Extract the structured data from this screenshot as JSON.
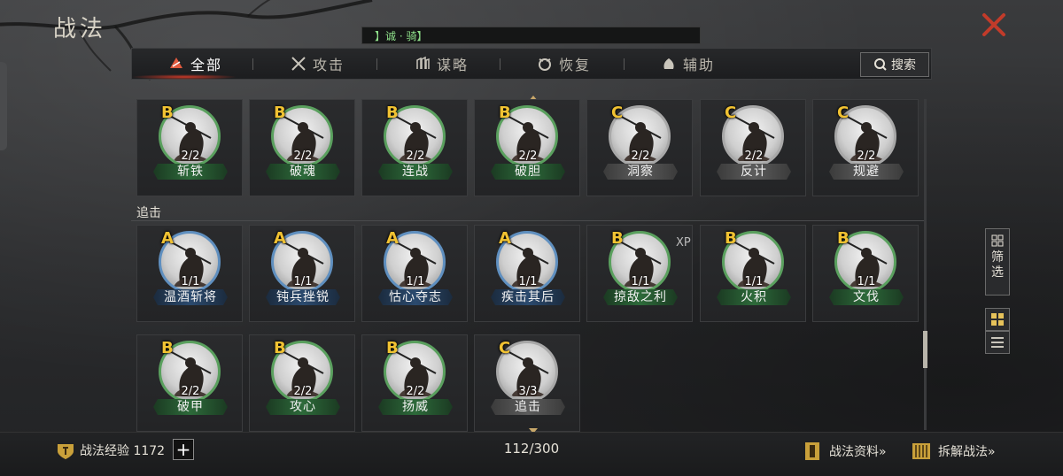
{
  "title": "战法",
  "marquee": "】诚 · 骑】",
  "tabs": [
    {
      "label": "全部",
      "icon": "all-icon",
      "active": true
    },
    {
      "label": "攻击",
      "icon": "crossed-swords-icon",
      "active": false
    },
    {
      "label": "谋略",
      "icon": "strategy-icon",
      "active": false
    },
    {
      "label": "恢复",
      "icon": "recover-icon",
      "active": false
    },
    {
      "label": "辅助",
      "icon": "assist-icon",
      "active": false
    }
  ],
  "search_label": "搜索",
  "row1": [
    {
      "grade": "B",
      "count": "2/2",
      "name": "斩铁",
      "color": "green"
    },
    {
      "grade": "B",
      "count": "2/2",
      "name": "破魂",
      "color": "green"
    },
    {
      "grade": "B",
      "count": "2/2",
      "name": "连战",
      "color": "green"
    },
    {
      "grade": "B",
      "count": "2/2",
      "name": "破胆",
      "color": "green"
    },
    {
      "grade": "C",
      "count": "2/2",
      "name": "洞察",
      "color": "gray"
    },
    {
      "grade": "C",
      "count": "2/2",
      "name": "反计",
      "color": "gray"
    },
    {
      "grade": "C",
      "count": "2/2",
      "name": "规避",
      "color": "gray"
    }
  ],
  "section_label": "追击",
  "row2": [
    {
      "grade": "A",
      "count": "1/1",
      "name": "温酒斩将",
      "color": "blue"
    },
    {
      "grade": "A",
      "count": "1/1",
      "name": "钝兵挫锐",
      "color": "blue"
    },
    {
      "grade": "A",
      "count": "1/1",
      "name": "怙心夺志",
      "color": "blue"
    },
    {
      "grade": "A",
      "count": "1/1",
      "name": "疾击其后",
      "color": "blue"
    },
    {
      "grade": "B",
      "count": "1/1",
      "name": "掠敌之利",
      "color": "green",
      "xp": "XP"
    },
    {
      "grade": "B",
      "count": "1/1",
      "name": "火积",
      "color": "green"
    },
    {
      "grade": "B",
      "count": "1/1",
      "name": "文伐",
      "color": "green"
    }
  ],
  "row3": [
    {
      "grade": "B",
      "count": "2/2",
      "name": "破甲",
      "color": "green"
    },
    {
      "grade": "B",
      "count": "2/2",
      "name": "攻心",
      "color": "green"
    },
    {
      "grade": "B",
      "count": "2/2",
      "name": "扬威",
      "color": "green"
    },
    {
      "grade": "C",
      "count": "3/3",
      "name": "追击",
      "color": "gray"
    }
  ],
  "filter_label": "筛选",
  "experience_label": "战法经验 1172",
  "capacity": "112/300",
  "links": [
    {
      "label": "战法资料»"
    },
    {
      "label": "拆解战法»"
    }
  ],
  "colors": {
    "grade": "#f1c232",
    "accent": "#c23b2a",
    "ring_blue": "#5f8fbf",
    "ring_green": "#5aa05e",
    "ring_gray": "#a8a8a8"
  }
}
